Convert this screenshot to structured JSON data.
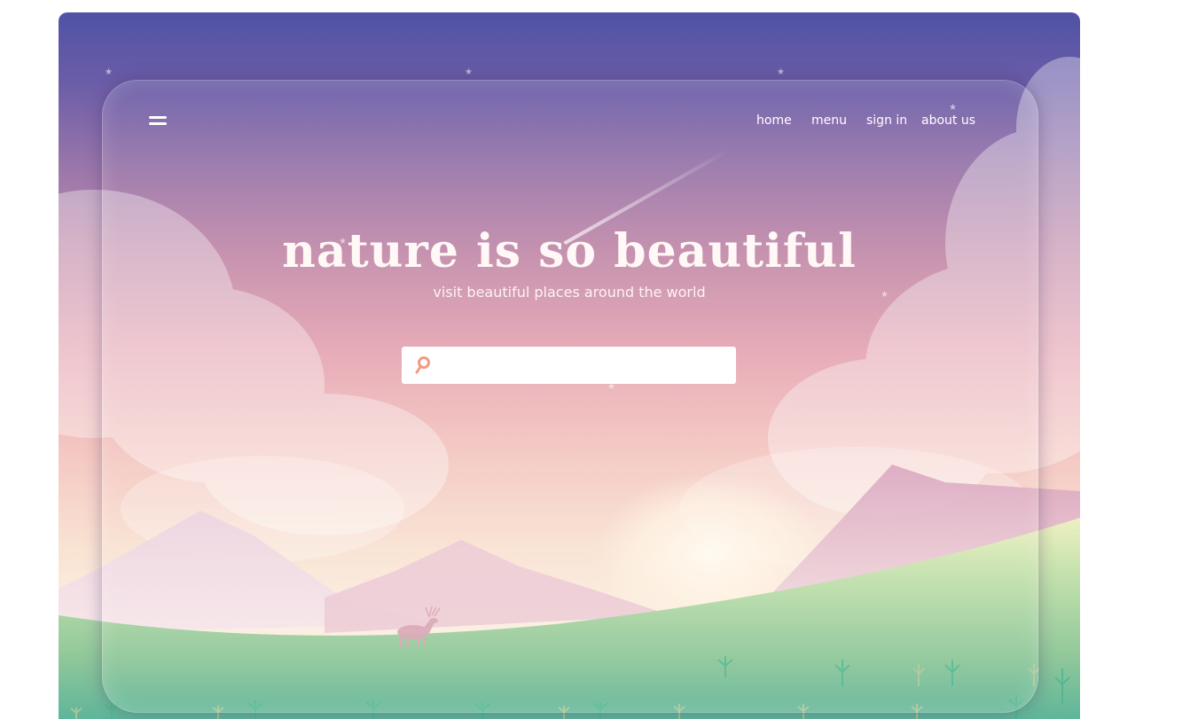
{
  "colors": {
    "sky_top": "#5052a5",
    "sky_mid": "#c08aaa",
    "sky_low": "#e6a7b4",
    "horizon": "#fbefe1",
    "grass": "#9ccf9b",
    "search_icon": "#f29a84",
    "text": "#ffffff"
  },
  "nav": {
    "menu_icon": "hamburger-menu-icon",
    "items": [
      {
        "label": "home"
      },
      {
        "label": "menu"
      },
      {
        "label": "sign in"
      },
      {
        "label": "about us"
      }
    ]
  },
  "hero": {
    "title": "nature is so beautiful",
    "subtitle": "visit beautiful places around the world"
  },
  "search": {
    "icon": "search-icon",
    "value": "",
    "placeholder": ""
  }
}
